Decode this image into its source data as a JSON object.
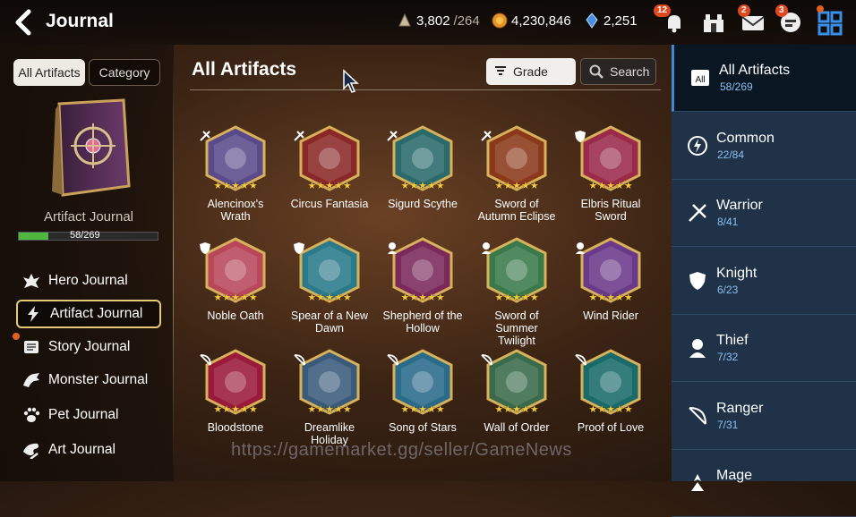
{
  "header": {
    "title": "Journal",
    "resources": [
      {
        "icon": "stamina-icon",
        "value": "3,802",
        "max": "/264"
      },
      {
        "icon": "gold-icon",
        "value": "4,230,846"
      },
      {
        "icon": "skystone-icon",
        "value": "2,251"
      }
    ],
    "icons": [
      {
        "name": "notification-bell-icon",
        "badge": "12"
      },
      {
        "name": "guild-icon",
        "badge": ""
      },
      {
        "name": "mail-icon",
        "badge": "2"
      },
      {
        "name": "chat-icon",
        "badge": "3"
      },
      {
        "name": "menu-grid-icon",
        "badge": ""
      }
    ]
  },
  "left": {
    "tabs": {
      "all": "All Artifacts",
      "category": "Category"
    },
    "journal_label": "Artifact Journal",
    "progress_text": "58/269",
    "progress_fraction": 0.2156,
    "menu": [
      {
        "label": "Hero Journal",
        "icon": "hero-icon"
      },
      {
        "label": "Artifact Journal",
        "icon": "artifact-icon"
      },
      {
        "label": "Story Journal",
        "icon": "story-icon"
      },
      {
        "label": "Monster Journal",
        "icon": "monster-icon"
      },
      {
        "label": "Pet Journal",
        "icon": "paw-icon"
      },
      {
        "label": "Art Journal",
        "icon": "art-icon"
      }
    ]
  },
  "main": {
    "title": "All Artifacts",
    "grade_label": "Grade",
    "search_label": "Search",
    "artifacts": [
      {
        "line1": "Alencinox's",
        "line2": "Wrath",
        "line3": "",
        "class": "warrior",
        "color": "#5a4a8a"
      },
      {
        "line1": "Circus Fantasia",
        "line2": "",
        "line3": "",
        "class": "warrior",
        "color": "#8a2828"
      },
      {
        "line1": "Sigurd Scythe",
        "line2": "",
        "line3": "",
        "class": "warrior",
        "color": "#2a6a6a"
      },
      {
        "line1": "Sword of",
        "line2": "Autumn Eclipse",
        "line3": "",
        "class": "warrior",
        "color": "#8a3a1a"
      },
      {
        "line1": "Elbris Ritual",
        "line2": "Sword",
        "line3": "",
        "class": "knight",
        "color": "#9a2a4a"
      },
      {
        "line1": "Noble Oath",
        "line2": "",
        "line3": "",
        "class": "knight",
        "color": "#b8475a"
      },
      {
        "line1": "Spear of a New",
        "line2": "Dawn",
        "line3": "",
        "class": "knight",
        "color": "#2a7a8a"
      },
      {
        "line1": "Shepherd of the",
        "line2": "Hollow",
        "line3": "",
        "class": "thief",
        "color": "#7a2a5a"
      },
      {
        "line1": "Sword of",
        "line2": "Summer",
        "line3": "Twilight",
        "class": "thief",
        "color": "#3a7a4a"
      },
      {
        "line1": "Wind Rider",
        "line2": "",
        "line3": "",
        "class": "thief",
        "color": "#6a3a8a"
      },
      {
        "line1": "Bloodstone",
        "line2": "",
        "line3": "",
        "class": "ranger",
        "color": "#9a1a3a"
      },
      {
        "line1": "Dreamlike",
        "line2": "Holiday",
        "line3": "",
        "class": "ranger",
        "color": "#3a5a7a"
      },
      {
        "line1": "Song of Stars",
        "line2": "",
        "line3": "",
        "class": "ranger",
        "color": "#2a6a8a"
      },
      {
        "line1": "Wall of Order",
        "line2": "",
        "line3": "",
        "class": "ranger",
        "color": "#3a6a4a"
      },
      {
        "line1": "Proof of Love",
        "line2": "",
        "line3": "",
        "class": "ranger",
        "color": "#1a6a6a"
      }
    ]
  },
  "categories": [
    {
      "label": "All Artifacts",
      "count": "58/269",
      "icon": "all-icon"
    },
    {
      "label": "Common",
      "count": "22/84",
      "icon": "common-icon"
    },
    {
      "label": "Warrior",
      "count": "8/41",
      "icon": "warrior-icon"
    },
    {
      "label": "Knight",
      "count": "6/23",
      "icon": "knight-icon"
    },
    {
      "label": "Thief",
      "count": "7/32",
      "icon": "thief-icon"
    },
    {
      "label": "Ranger",
      "count": "7/31",
      "icon": "ranger-icon"
    },
    {
      "label": "Mage",
      "count": "",
      "icon": "mage-icon"
    }
  ],
  "watermark": "https://gamemarket.gg/seller/GameNews",
  "colors": {
    "accent_blue": "#3f88d6",
    "gold": "#e4c978",
    "progress_green": "#4fb640",
    "badge_orange": "#e0481f"
  }
}
